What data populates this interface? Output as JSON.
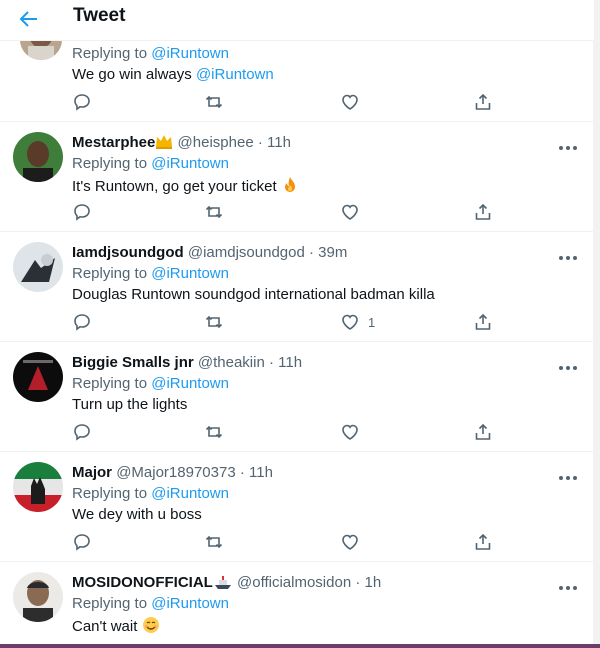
{
  "header": {
    "title": "Tweet",
    "back_icon": "arrow-left-icon"
  },
  "colors": {
    "accent": "#1d9bf0",
    "muted": "#536471",
    "text": "#0f1419"
  },
  "tweets": [
    {
      "name": "",
      "handle": "",
      "time": "",
      "reply_label": "Replying to",
      "reply_to": "@iRuntown",
      "text_before": "We go win always",
      "text_link": "@iRuntown",
      "like_count": ""
    },
    {
      "name": "Mestarphee",
      "name_emoji": "crown-icon",
      "handle": "@heisphee",
      "time": "· 11h",
      "reply_label": "Replying to",
      "reply_to": "@iRuntown",
      "text": "It's Runtown, go get your ticket",
      "text_emoji": "fire-icon",
      "like_count": ""
    },
    {
      "name": "Iamdjsoundgod",
      "handle": "@iamdjsoundgod",
      "time": "· 39m",
      "reply_label": "Replying to",
      "reply_to": "@iRuntown",
      "text": "Douglas Runtown soundgod international badman killa",
      "like_count": "1"
    },
    {
      "name": "Biggie Smalls jnr",
      "handle": "@theakiin",
      "time": "· 11h",
      "reply_label": "Replying to",
      "reply_to": "@iRuntown",
      "text": "Turn up the lights",
      "like_count": ""
    },
    {
      "name": "Major",
      "handle": "@Major18970373",
      "time": "· 11h",
      "reply_label": "Replying to",
      "reply_to": "@iRuntown",
      "text": "We dey with u boss",
      "like_count": ""
    },
    {
      "name": "MOSIDONOFFICIAL",
      "name_emoji": "ship-icon",
      "handle": "@officialmosidon",
      "time": "· 1h",
      "reply_label": "Replying to",
      "reply_to": "@iRuntown",
      "text": "Can't wait",
      "text_emoji": "smiling-face-icon",
      "like_count": ""
    }
  ]
}
